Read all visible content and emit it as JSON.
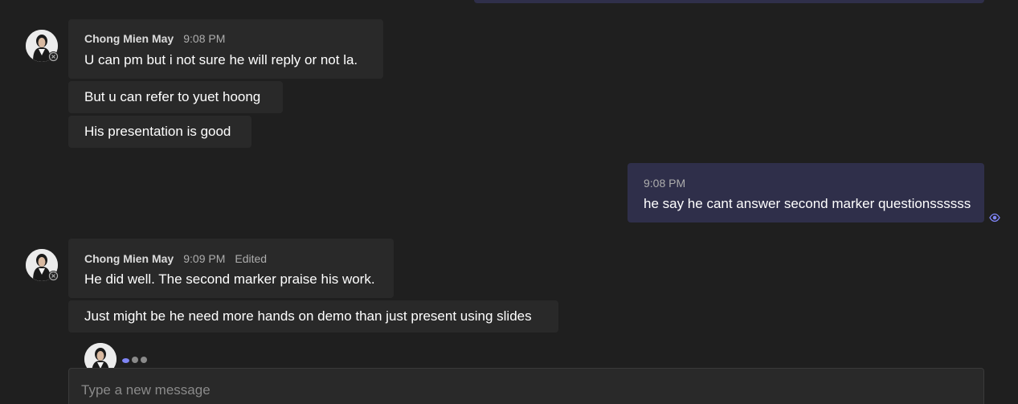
{
  "colors": {
    "background": "#1f1f1f",
    "incoming_bubble": "#292929",
    "outgoing_bubble": "#2f2f4a",
    "accent": "#7f85f5"
  },
  "messages": {
    "group1": {
      "sender": "Chong Mien May",
      "time": "9:08 PM",
      "lines": [
        "U can pm but i not sure he will reply or not la.",
        "But u can refer to yuet hoong",
        "His presentation is good"
      ]
    },
    "mine1": {
      "time": "9:08 PM",
      "text": "he say he cant answer second marker questionssssss",
      "read_receipt_icon": "eye-icon"
    },
    "group2": {
      "sender": "Chong Mien May",
      "time": "9:09 PM",
      "edited": "Edited",
      "lines": [
        "He did well. The second marker praise his work.",
        "Just might be he need more hands on demo than just present using slides"
      ]
    }
  },
  "typing_indicator": {
    "icon": "typing-dots-icon"
  },
  "compose": {
    "placeholder": "Type a new message"
  }
}
